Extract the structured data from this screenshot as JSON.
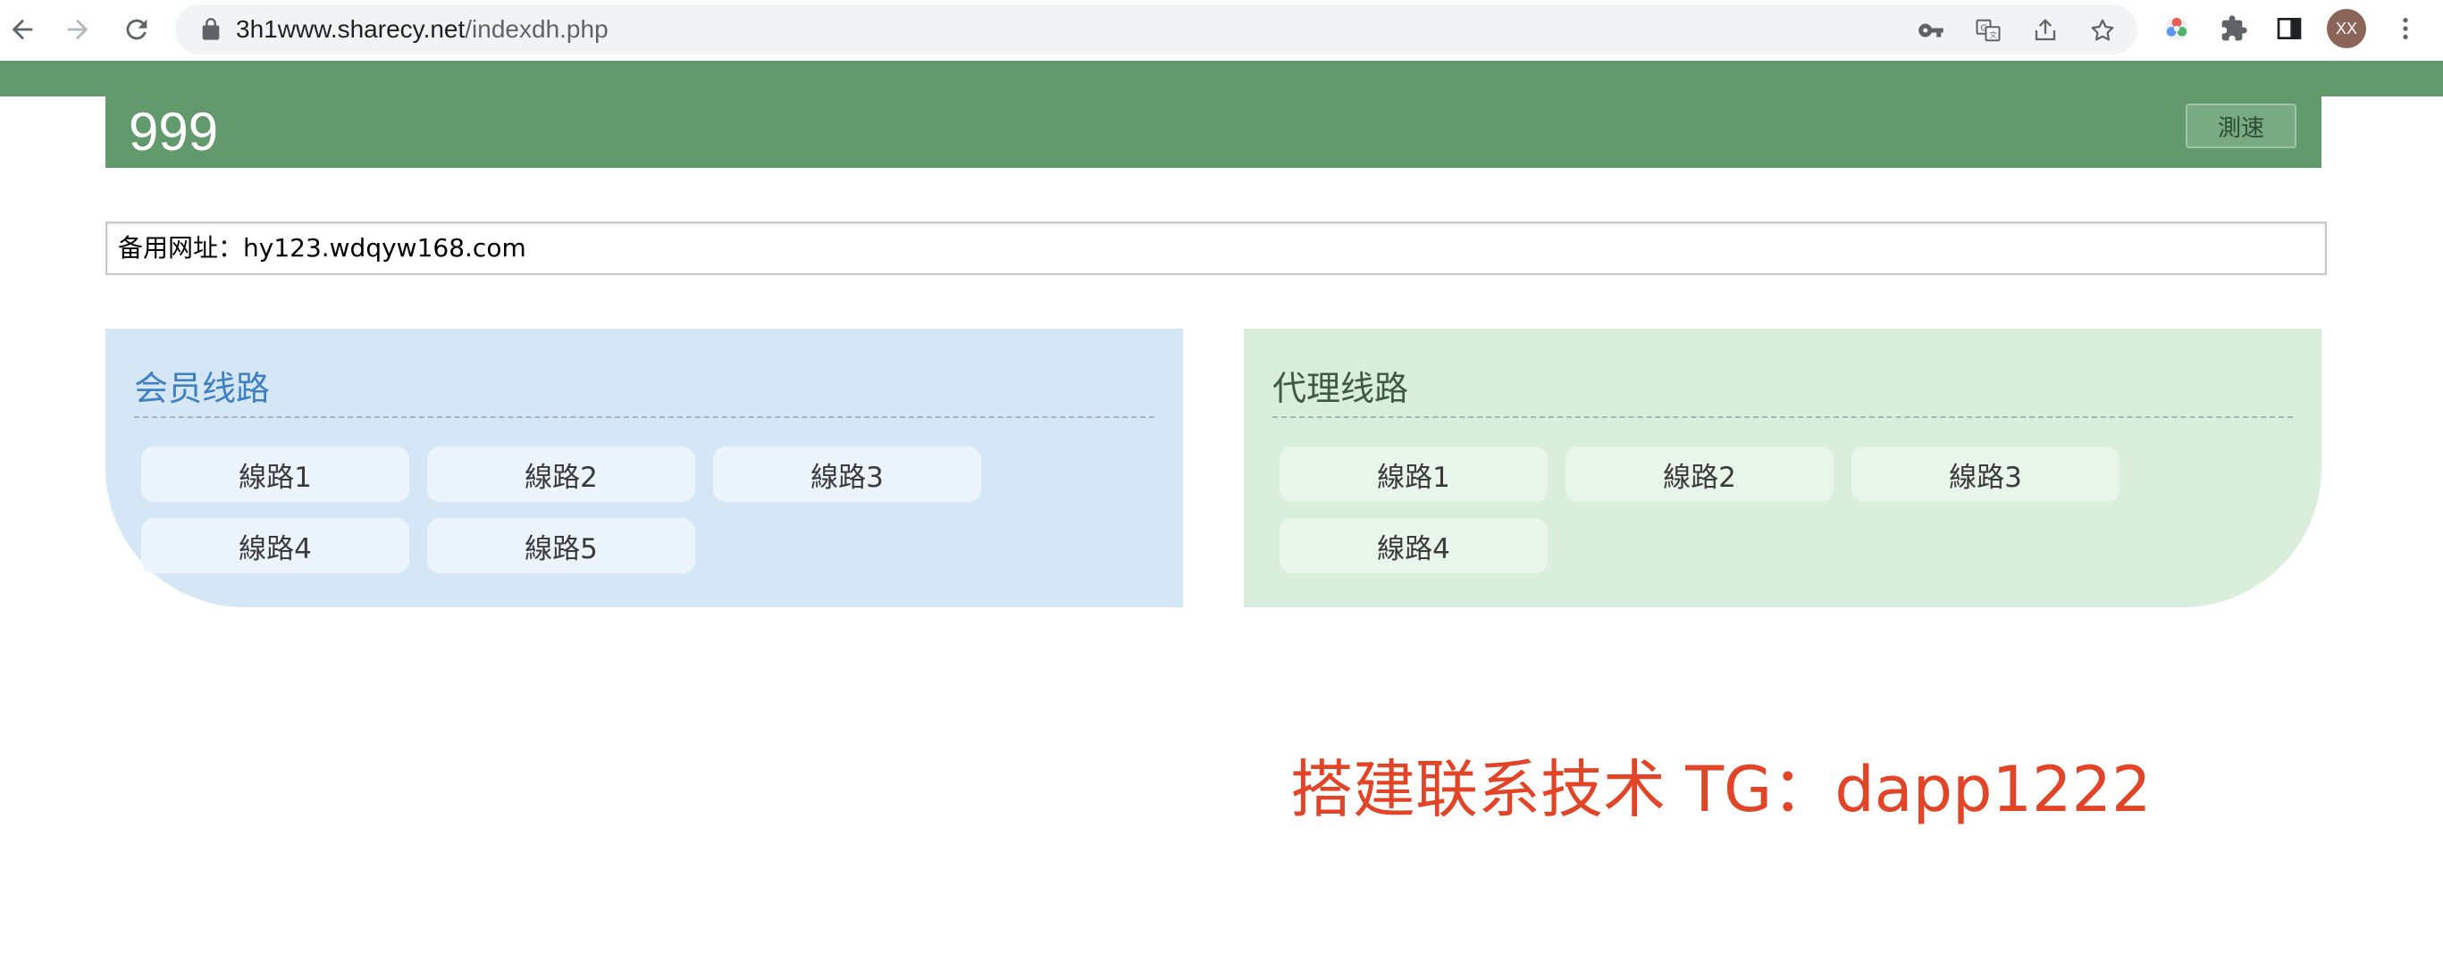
{
  "browser": {
    "url_host": "3h1www.sharecy.net",
    "url_path": "/indexdh.php",
    "profile_initials": "XX",
    "icons": [
      "back-icon",
      "forward-icon",
      "reload-icon",
      "lock-icon",
      "key-icon",
      "translate-icon",
      "share-icon",
      "star-icon",
      "extension-color-icon",
      "puzzle-icon",
      "sidepanel-icon",
      "more-icon"
    ]
  },
  "header": {
    "title": "999",
    "speed_test_label": "測速",
    "color": "#629a6e"
  },
  "backup": {
    "text": "备用网址：hy123.wdqyw168.com"
  },
  "member_panel": {
    "title": "会员线路",
    "lines": [
      "線路1",
      "線路2",
      "線路3",
      "線路4",
      "線路5"
    ],
    "color": "#d5e7f7"
  },
  "agent_panel": {
    "title": "代理线路",
    "lines": [
      "線路1",
      "線路2",
      "線路3",
      "線路4"
    ],
    "color": "#d9efdb"
  },
  "contact": {
    "text": "搭建联系技术 TG：dapp1222",
    "color": "#e14426"
  }
}
